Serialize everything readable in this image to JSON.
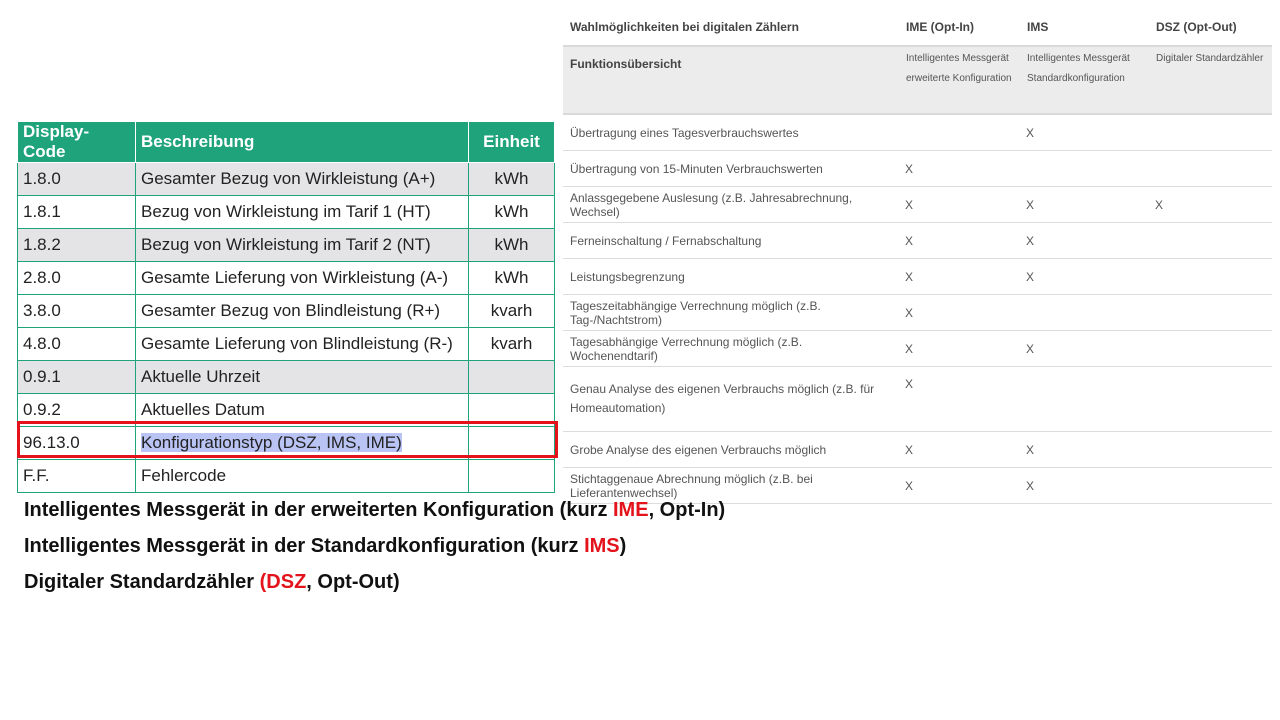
{
  "codes_table": {
    "headers": {
      "code": "Display-Code",
      "desc": "Beschreibung",
      "unit": "Einheit"
    },
    "rows": [
      {
        "code": "1.8.0",
        "desc": "Gesamter Bezug von Wirkleistung (A+)",
        "unit": "kWh"
      },
      {
        "code": "1.8.1",
        "desc": "Bezug von Wirkleistung im Tarif 1 (HT)",
        "unit": "kWh"
      },
      {
        "code": "1.8.2",
        "desc": "Bezug von Wirkleistung im Tarif 2 (NT)",
        "unit": "kWh"
      },
      {
        "code": "2.8.0",
        "desc": "Gesamte Lieferung von Wirkleistung (A-)",
        "unit": "kWh"
      },
      {
        "code": "3.8.0",
        "desc": "Gesamter Bezug von Blindleistung (R+)",
        "unit": "kvarh"
      },
      {
        "code": "4.8.0",
        "desc": "Gesamte Lieferung von Blindleistung (R-)",
        "unit": "kvarh"
      },
      {
        "code": "0.9.1",
        "desc": "Aktuelle Uhrzeit",
        "unit": ""
      },
      {
        "code": "0.9.2",
        "desc": "Aktuelles Datum",
        "unit": ""
      },
      {
        "code": "96.13.0",
        "desc": "Konfigurationstyp (DSZ, IMS, IME)",
        "unit": ""
      },
      {
        "code": "F.F.",
        "desc": "Fehlercode",
        "unit": ""
      }
    ]
  },
  "options_table": {
    "headers": {
      "title": "Wahlmöglichkeiten bei digitalen Zählern",
      "ime": "IME (Opt-In)",
      "ims": "IMS",
      "dsz": "DSZ (Opt-Out)"
    },
    "function_row": {
      "label": "Funktionsübersicht",
      "ime_line1": "Intelligentes Messgerät",
      "ime_line2": "erweiterte Konfiguration",
      "ims_line1": "Intelligentes Messgerät",
      "ims_line2": "Standardkonfiguration",
      "dsz": "Digitaler Standardzähler"
    },
    "rows": [
      {
        "feature": "Übertragung eines Tagesverbrauchswertes",
        "ime": "",
        "ims": "X",
        "dsz": ""
      },
      {
        "feature": "Übertragung von 15-Minuten Verbrauchswerten",
        "ime": "X",
        "ims": "",
        "dsz": ""
      },
      {
        "feature": "Anlassgegebene Auslesung (z.B. Jahresabrechnung, Wechsel)",
        "ime": "X",
        "ims": "X",
        "dsz": "X"
      },
      {
        "feature": "Ferneinschaltung / Fernabschaltung",
        "ime": "X",
        "ims": "X",
        "dsz": ""
      },
      {
        "feature": "Leistungsbegrenzung",
        "ime": "X",
        "ims": "X",
        "dsz": ""
      },
      {
        "feature": "Tageszeitabhängige Verrechnung möglich (z.B. Tag-/Nachtstrom)",
        "ime": "X",
        "ims": "",
        "dsz": ""
      },
      {
        "feature": "Tagesabhängige Verrechnung möglich (z.B. Wochenendtarif)",
        "ime": "X",
        "ims": "X",
        "dsz": ""
      },
      {
        "feature": "Genau Analyse des eigenen Verbrauchs möglich (z.B. für Homeautomation)",
        "ime": "X",
        "ims": "",
        "dsz": ""
      },
      {
        "feature": "Grobe Analyse des eigenen Verbrauchs möglich",
        "ime": "X",
        "ims": "X",
        "dsz": ""
      },
      {
        "feature": "Stichtaggenaue Abrechnung möglich (z.B. bei Lieferantenwechsel)",
        "ime": "X",
        "ims": "X",
        "dsz": ""
      }
    ]
  },
  "legend": {
    "line1_a": "Intelligentes Messgerät in der erweiterten Konfiguration (kurz ",
    "line1_abbr": "IME",
    "line1_b": ", Opt-In)",
    "line2_a": "Intelligentes Messgerät in der Standardkonfiguration (kurz ",
    "line2_abbr": "IMS",
    "line2_b": ")",
    "line3_a": "Digitaler Standardzähler ",
    "line3_abbr": "(DSZ",
    "line3_b": ", Opt-Out)"
  },
  "colors": {
    "table_green": "#1fa37a",
    "highlight_red": "#e3121b",
    "selection": "#b9c3f4"
  }
}
